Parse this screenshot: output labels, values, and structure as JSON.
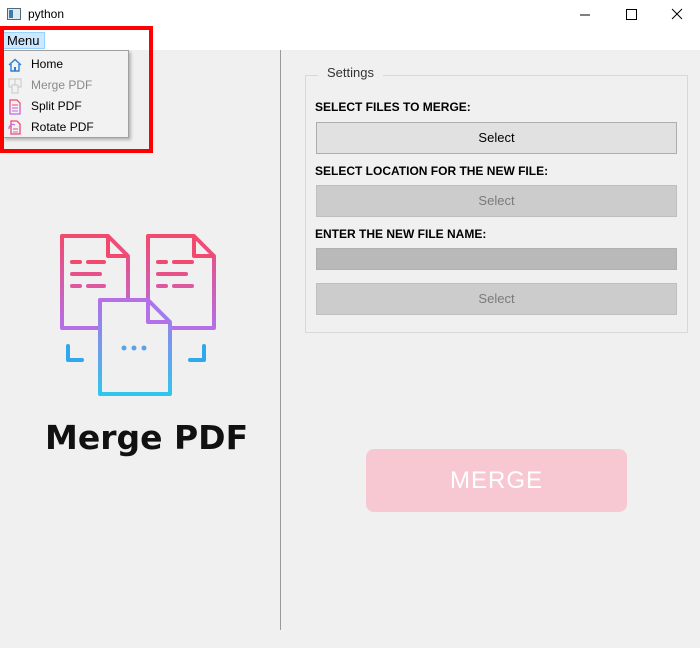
{
  "window": {
    "title": "python",
    "minimize_icon": "minimize-icon",
    "maximize_icon": "maximize-icon",
    "close_icon": "close-icon"
  },
  "menubar": {
    "menu_label": "Menu",
    "items": [
      {
        "label": "Home",
        "icon": "home-icon",
        "enabled": true
      },
      {
        "label": "Merge PDF",
        "icon": "merge-pdf-icon",
        "enabled": false
      },
      {
        "label": "Split PDF",
        "icon": "split-pdf-icon",
        "enabled": true
      },
      {
        "label": "Rotate PDF",
        "icon": "rotate-pdf-icon",
        "enabled": true
      }
    ]
  },
  "logo": {
    "text": "Merge PDF",
    "icon": "merge-documents-icon"
  },
  "settings": {
    "title": "Settings",
    "select_files_label": "SELECT FILES TO MERGE:",
    "select_files_button": "Select",
    "select_location_label": "SELECT LOCATION FOR THE NEW FILE:",
    "select_location_button": "Select",
    "file_name_label": "ENTER THE NEW FILE NAME:",
    "file_name_value": "",
    "confirm_name_button": "Select"
  },
  "merge_button": "MERGE",
  "colors": {
    "accent_pink": "#f8c8d2",
    "highlight_red": "#ff0000",
    "menu_hover": "#cce8ff"
  }
}
